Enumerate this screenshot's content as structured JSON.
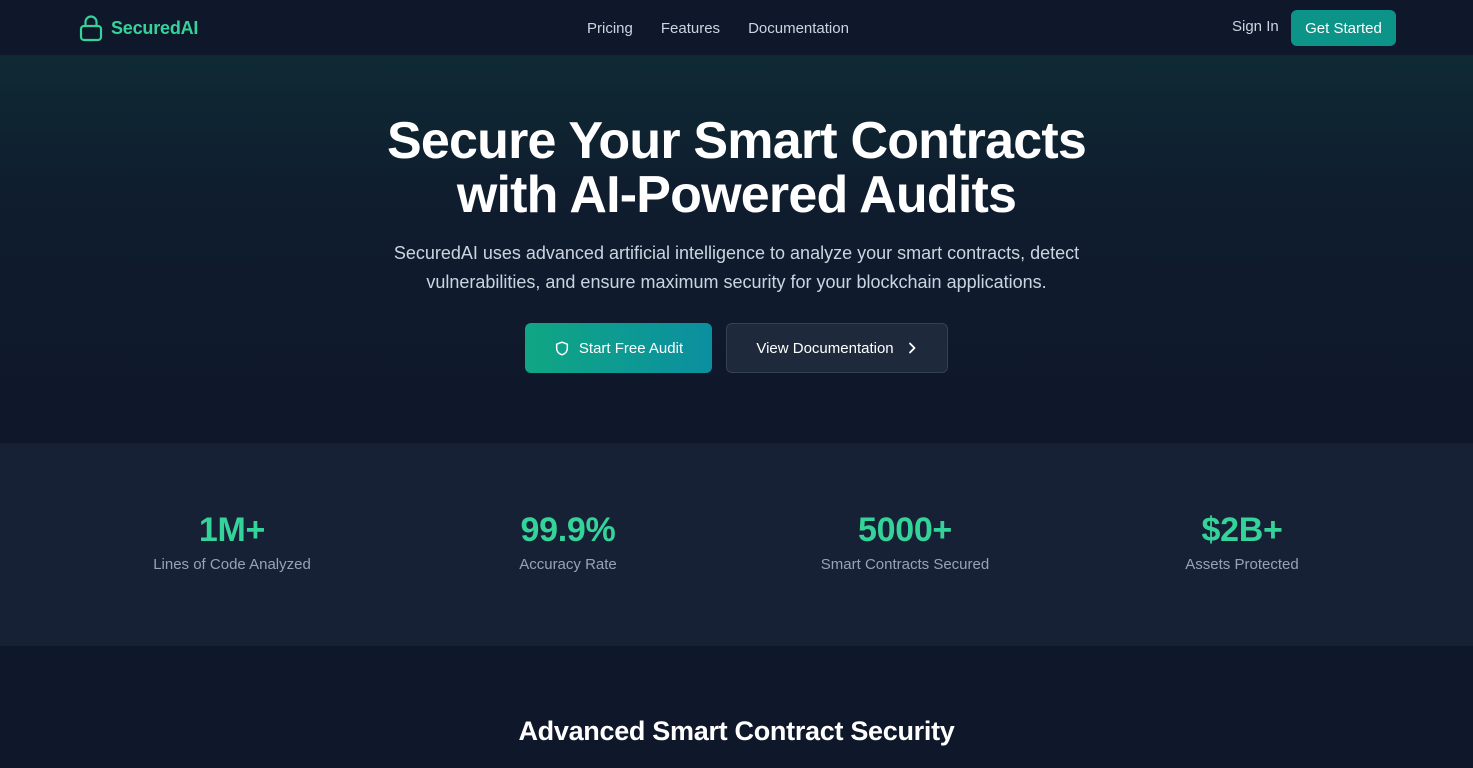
{
  "header": {
    "brand": "SecuredAI",
    "nav": [
      "Pricing",
      "Features",
      "Documentation"
    ],
    "sign_in": "Sign In",
    "get_started": "Get Started",
    "brand_color": "#34d399",
    "accent_color": "#0d9488"
  },
  "hero": {
    "title_line1": "Secure Your Smart Contracts",
    "title_line2": "with AI-Powered Audits",
    "subtitle_line1": "SecuredAI uses advanced artificial intelligence to analyze your smart contracts, detect",
    "subtitle_line2": "vulnerabilities, and ensure maximum security for your blockchain applications.",
    "primary_cta": "Start Free Audit",
    "primary_cta_icon": "shield-icon",
    "secondary_cta": "View Documentation",
    "secondary_cta_icon": "chevron-right-icon"
  },
  "stats": [
    {
      "value": "1M+",
      "label": "Lines of Code Analyzed"
    },
    {
      "value": "99.9%",
      "label": "Accuracy Rate"
    },
    {
      "value": "5000+",
      "label": "Smart Contracts Secured"
    },
    {
      "value": "$2B+",
      "label": "Assets Protected"
    }
  ],
  "features": {
    "title": "Advanced Smart Contract Security"
  }
}
